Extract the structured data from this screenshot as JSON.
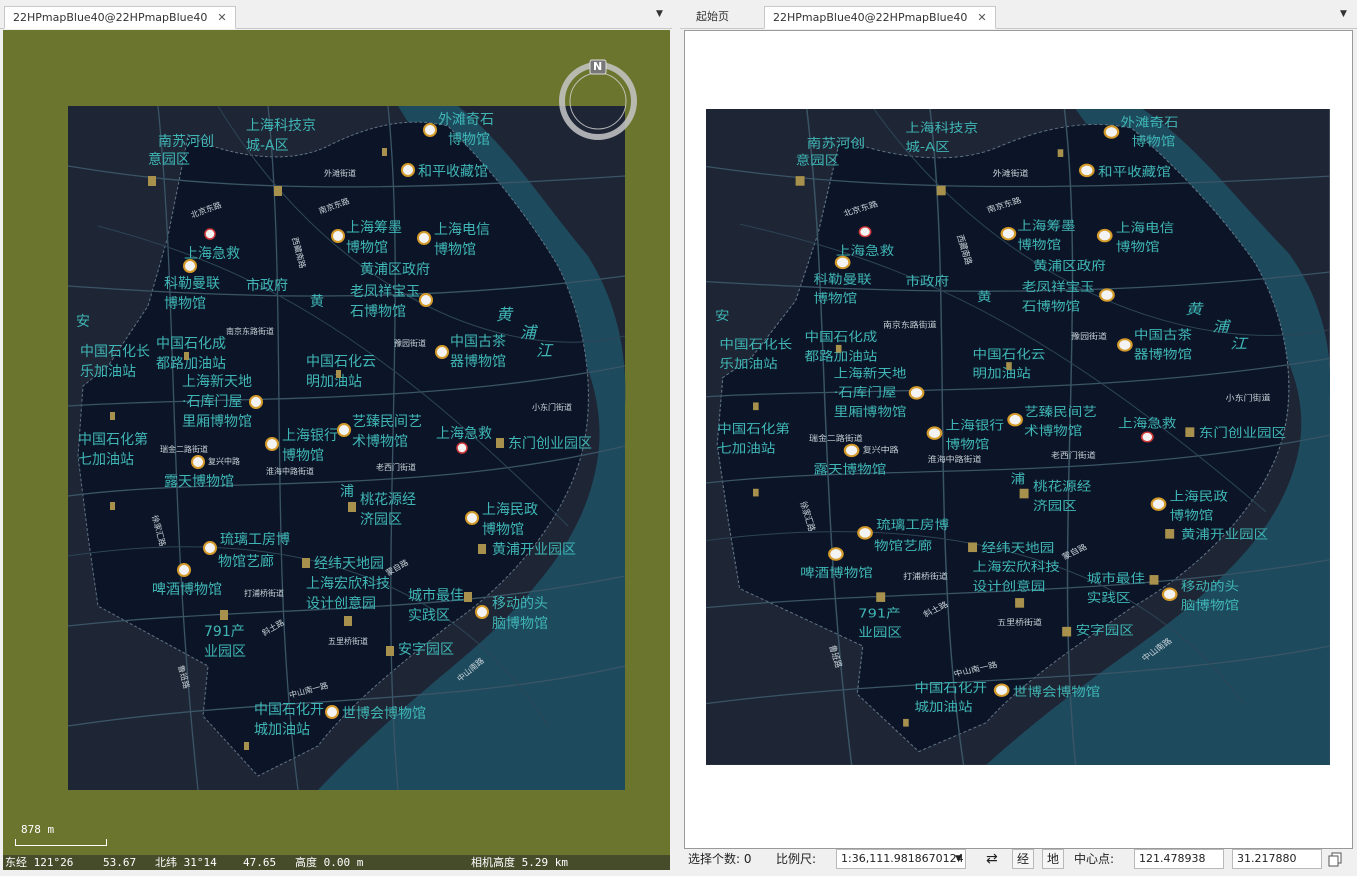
{
  "left_pane": {
    "tab": {
      "label": "22HPmapBlue40@22HPmapBlue40"
    },
    "compass": {
      "north_label": "N"
    },
    "scale_label": "878 m",
    "coord_bar": {
      "lon_label": "东经 121°26",
      "lon_sec": "53.67",
      "lat_label": "北纬 31°14",
      "lat_sec": "47.65",
      "height_label": "高度 0.00 m",
      "camera_label": "相机高度 5.29 km"
    }
  },
  "right_pane": {
    "tabs": [
      {
        "label": "起始页"
      },
      {
        "label": "22HPmapBlue40@22HPmapBlue40"
      }
    ]
  },
  "map": {
    "colors": {
      "water": "#1e4a5e",
      "land": "#0c1527",
      "outside": "#1e2535",
      "label": "#3fb6b5"
    },
    "labels": {
      "l1": "南苏河创",
      "l2": "意园区",
      "l3": "上海科技京",
      "l4": "城-A区",
      "l5": "外滩奇石",
      "l6": "博物馆",
      "l7": "和平收藏馆",
      "l8": "上海筹墨",
      "l9": "博物馆",
      "l10": "上海电信",
      "l11": "博物馆",
      "l12": "上海急救",
      "l13": "科勒曼联",
      "l14": "博物馆",
      "l15": "市政府",
      "l16": "黄浦区政府",
      "l17": "老凤祥宝玉",
      "l18": "石博物馆",
      "l19": "中国石化长",
      "l20": "乐加油站",
      "l21": "中国石化成",
      "l22": "都路加油站",
      "l23": "上海新天地",
      "l24": "·石库门屋",
      "l25": "里厢博物馆",
      "l26": "中国石化云",
      "l27": "明加油站",
      "l28": "中国古茶",
      "l29": "器博物馆",
      "l30": "中国石化第",
      "l31": "七加油站",
      "l32": "上海银行",
      "l33": "博物馆",
      "l34": "艺臻民间艺",
      "l35": "术博物馆",
      "l36": "上海急救",
      "l37": "东门创业园区",
      "l38": "露天博物馆",
      "l39": "桃花源经",
      "l40": "济园区",
      "l41": "上海民政",
      "l42": "博物馆",
      "l43": "黄浦开业园区",
      "l44": "琉璃工房博",
      "l45": "物馆艺廊",
      "l46": "经纬天地园",
      "l47": "上海宏欣科技",
      "l48": "设计创意园",
      "l49": "啤酒博物馆",
      "l50": "城市最佳",
      "l51": "实践区",
      "l52": "移动的头",
      "l53": "脑博物馆",
      "l54": "791产",
      "l55": "业园区",
      "l56": "安字园区",
      "l57": "中国石化开",
      "l58": "城加油站",
      "l59": "世博会博物馆",
      "l60": "黄",
      "l61": "浦",
      "l62": "江",
      "l63": "黄",
      "l64": "浦",
      "l65": "安"
    },
    "streets": {
      "s1": "外滩街道",
      "s2": "南京东路街道",
      "s3": "豫园街道",
      "s4": "小东门街道",
      "s5": "瑞金二路街道",
      "s6": "淮海中路街道",
      "s7": "老西门街道",
      "s8": "打浦桥街道",
      "s9": "五里桥街道",
      "s10": "北京东路",
      "s11": "南京东路",
      "s12": "复兴中路",
      "s13": "中山南一路",
      "s14": "西藏南路",
      "s15": "斜土路",
      "s16": "中山南路",
      "s17": "徐家汇路",
      "s18": "蒙自路",
      "s19": "鲁班路"
    }
  },
  "statusbar": {
    "select_count_label": "选择个数: 0",
    "scale_label": "比例尺:",
    "scale_value": "1:36,111.9818670124",
    "swap_icon": "⇄",
    "jing_btn": "经",
    "di_btn": "地",
    "center_label": "中心点:",
    "center_x": "121.478938",
    "center_y": "31.217880"
  }
}
